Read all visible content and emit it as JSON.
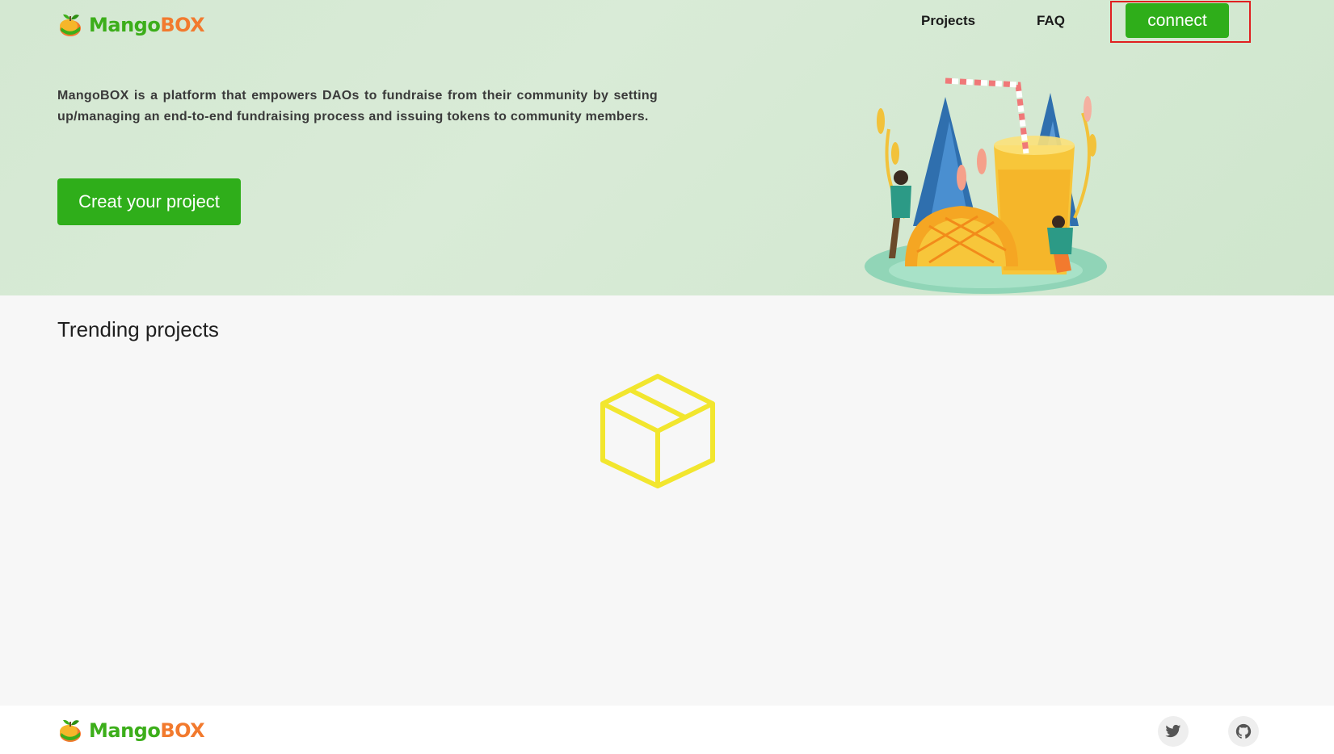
{
  "brand": {
    "name_part1": "Mango",
    "name_part2": "BOX",
    "primary_color": "#3cae1a",
    "accent_color": "#f27a2e"
  },
  "nav": {
    "items": [
      {
        "label": "Projects"
      },
      {
        "label": "FAQ"
      }
    ],
    "connect_label": "connect"
  },
  "hero": {
    "description": "MangoBOX is a platform that empowers DAOs to fundraise from their community by setting up/managing an end-to-end fundraising process and issuing tokens to community members.",
    "cta_label": "Creat your project"
  },
  "trending": {
    "title": "Trending projects",
    "empty_icon": "empty-box-icon"
  },
  "footer": {
    "social": [
      {
        "icon": "twitter-icon"
      },
      {
        "icon": "github-icon"
      }
    ]
  },
  "colors": {
    "button_green": "#2fae1a",
    "highlight_red": "#e02020",
    "empty_icon_yellow": "#f2e62e"
  }
}
